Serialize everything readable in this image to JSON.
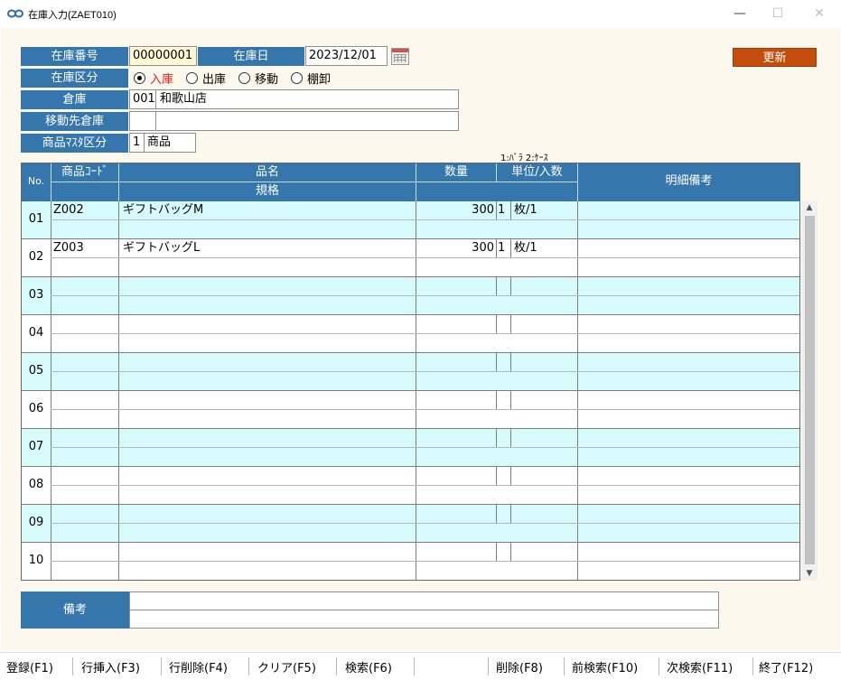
{
  "window": {
    "title": "在庫入力(ZAET010)",
    "minimize": "—",
    "maximize": "☐",
    "close": "✕"
  },
  "header": {
    "stock_no_label": "在庫番号",
    "stock_no_value": "00000001",
    "stock_date_label": "在庫日",
    "stock_date_value": "2023/12/01",
    "stock_type_label": "在庫区分",
    "stock_types": [
      "入庫",
      "出庫",
      "移動",
      "棚卸"
    ],
    "stock_type_selected": 0,
    "warehouse_label": "倉庫",
    "warehouse_code": "001",
    "warehouse_name": "和歌山店",
    "dest_warehouse_label": "移動先倉庫",
    "dest_warehouse_code": "",
    "dest_warehouse_name": "",
    "master_type_label": "商品ﾏｽﾀ区分",
    "master_type_code": "1",
    "master_type_name": "商品",
    "update_button": "更新",
    "unit_hint": "1:ﾊﾞﾗ 2:ｹｰｽ"
  },
  "grid": {
    "headers": {
      "no": "No.",
      "code": "商品ｺｰﾄﾞ",
      "name": "品名",
      "spec": "規格",
      "qty": "数量",
      "unit": "単位/入数",
      "remarks": "明細備考"
    },
    "rows": [
      {
        "no": "01",
        "code": "Z002",
        "name": "ギフトバッグM",
        "spec": "",
        "qty": "300",
        "unit_type": "1",
        "unit": "枚/1",
        "remarks": ""
      },
      {
        "no": "02",
        "code": "Z003",
        "name": "ギフトバッグL",
        "spec": "",
        "qty": "300",
        "unit_type": "1",
        "unit": "枚/1",
        "remarks": ""
      },
      {
        "no": "03",
        "code": "",
        "name": "",
        "spec": "",
        "qty": "",
        "unit_type": "",
        "unit": "",
        "remarks": ""
      },
      {
        "no": "04",
        "code": "",
        "name": "",
        "spec": "",
        "qty": "",
        "unit_type": "",
        "unit": "",
        "remarks": ""
      },
      {
        "no": "05",
        "code": "",
        "name": "",
        "spec": "",
        "qty": "",
        "unit_type": "",
        "unit": "",
        "remarks": ""
      },
      {
        "no": "06",
        "code": "",
        "name": "",
        "spec": "",
        "qty": "",
        "unit_type": "",
        "unit": "",
        "remarks": ""
      },
      {
        "no": "07",
        "code": "",
        "name": "",
        "spec": "",
        "qty": "",
        "unit_type": "",
        "unit": "",
        "remarks": ""
      },
      {
        "no": "08",
        "code": "",
        "name": "",
        "spec": "",
        "qty": "",
        "unit_type": "",
        "unit": "",
        "remarks": ""
      },
      {
        "no": "09",
        "code": "",
        "name": "",
        "spec": "",
        "qty": "",
        "unit_type": "",
        "unit": "",
        "remarks": ""
      },
      {
        "no": "10",
        "code": "",
        "name": "",
        "spec": "",
        "qty": "",
        "unit_type": "",
        "unit": "",
        "remarks": ""
      }
    ]
  },
  "footer": {
    "remarks_label": "備考",
    "remarks_line1": "",
    "remarks_line2": ""
  },
  "fkeys": [
    {
      "id": "register",
      "label": "登録(F1)"
    },
    {
      "id": "insert-row",
      "label": "行挿入(F3)"
    },
    {
      "id": "delete-row",
      "label": "行削除(F4)"
    },
    {
      "id": "clear",
      "label": "クリア(F5)"
    },
    {
      "id": "search",
      "label": "検索(F6)"
    },
    {
      "id": "delete",
      "label": "削除(F8)"
    },
    {
      "id": "prev-search",
      "label": "前検索(F10)"
    },
    {
      "id": "next-search",
      "label": "次検索(F11)"
    },
    {
      "id": "exit",
      "label": "終了(F12)"
    }
  ],
  "colors": {
    "label_bg": "#3576ad",
    "update_button_bg": "#c24d0c",
    "alt_row_bg": "#d7fbfb",
    "client_bg": "#fdf8ee",
    "selected_radio_text": "#d9211e"
  }
}
